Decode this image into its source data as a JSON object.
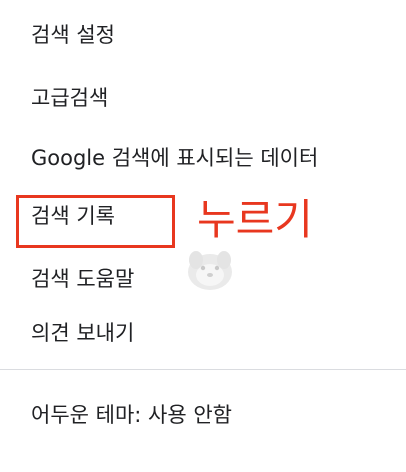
{
  "menu": {
    "items": [
      {
        "label": "검색 설정"
      },
      {
        "label": "고급검색"
      },
      {
        "label": "Google 검색에 표시되는 데이터"
      },
      {
        "label": "검색 기록"
      },
      {
        "label": "검색 도움말"
      },
      {
        "label": "의견 보내기"
      },
      {
        "label": "어두운 테마: 사용 안함"
      }
    ]
  },
  "annotation": {
    "text": "누르기",
    "color": "#e8371f"
  },
  "colors": {
    "text": "#202124",
    "divider": "#dadce0",
    "highlight": "#e8371f"
  }
}
